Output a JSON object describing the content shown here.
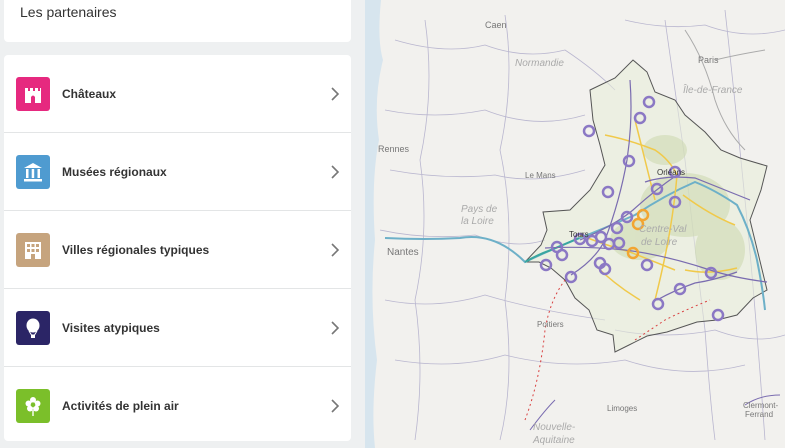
{
  "sidebar": {
    "title": "Les partenaires",
    "categories": [
      {
        "label": "Châteaux",
        "icon": "castle-icon",
        "color": "#e6297f"
      },
      {
        "label": "Musées régionaux",
        "icon": "museum-icon",
        "color": "#4f9bd0"
      },
      {
        "label": "Villes régionales typiques",
        "icon": "building-icon",
        "color": "#c6a47e"
      },
      {
        "label": "Visites atypiques",
        "icon": "balloon-icon",
        "color": "#2b2566"
      },
      {
        "label": "Activités de plein air",
        "icon": "flower-icon",
        "color": "#7bbf2a"
      }
    ]
  },
  "map": {
    "places": {
      "caen": "Caen",
      "normandie": "Normandie",
      "paris": "Paris",
      "ile_de_france": "Île-de-France",
      "rennes": "Rennes",
      "le_mans": "Le Mans",
      "orleans": "Orléans",
      "pays_de_la_loire_1": "Pays de",
      "pays_de_la_loire_2": "la Loire",
      "nantes": "Nantes",
      "tours": "Tours",
      "centre_val_de_loire_1": "Centre-Val",
      "centre_val_de_loire_2": "de Loire",
      "poitiers": "Poitiers",
      "limoges": "Limoges",
      "nouvelle_aquitaine_1": "Nouvelle-",
      "nouvelle_aquitaine_2": "Aquitaine",
      "clermont_1": "Clermont-",
      "clermont_2": "Ferrand"
    },
    "marker_color_partner": "#8b78c4",
    "marker_color_highlight": "#f2a531"
  }
}
